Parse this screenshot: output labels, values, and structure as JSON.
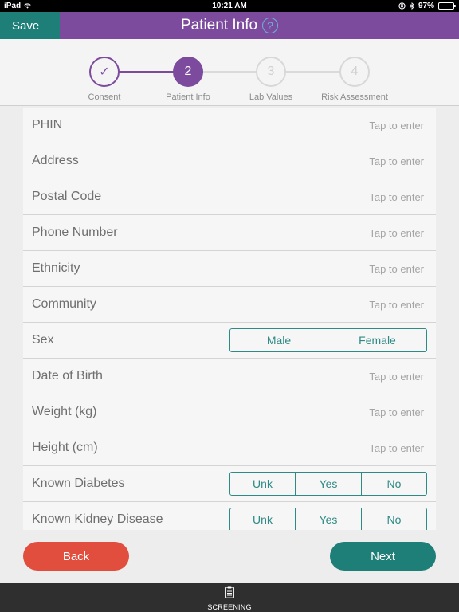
{
  "status_bar": {
    "device": "iPad",
    "time": "10:21 AM",
    "battery": "97%",
    "icons": [
      "wifi-icon",
      "orientation-lock-icon",
      "bluetooth-icon",
      "battery-icon"
    ]
  },
  "header": {
    "save_label": "Save",
    "title": "Patient Info",
    "help_glyph": "?"
  },
  "stepper": {
    "steps": [
      {
        "number": "✓",
        "label": "Consent",
        "state": "done"
      },
      {
        "number": "2",
        "label": "Patient Info",
        "state": "active"
      },
      {
        "number": "3",
        "label": "Lab Values",
        "state": "pending"
      },
      {
        "number": "4",
        "label": "Risk Assessment",
        "state": "pending"
      }
    ]
  },
  "form": {
    "rows": [
      {
        "label": "PHIN",
        "value": "Tap to enter"
      },
      {
        "label": "Address",
        "value": "Tap to enter"
      },
      {
        "label": "Postal Code",
        "value": "Tap to enter"
      },
      {
        "label": "Phone Number",
        "value": "Tap to enter"
      },
      {
        "label": "Ethnicity",
        "value": "Tap to enter"
      },
      {
        "label": "Community",
        "value": "Tap to enter"
      },
      {
        "label": "Sex",
        "options": [
          "Male",
          "Female"
        ]
      },
      {
        "label": "Date of Birth",
        "value": "Tap to enter"
      },
      {
        "label": "Weight (kg)",
        "value": "Tap to enter"
      },
      {
        "label": "Height (cm)",
        "value": "Tap to enter"
      },
      {
        "label": "Known Diabetes",
        "options": [
          "Unk",
          "Yes",
          "No"
        ]
      },
      {
        "label": "Known Kidney Disease",
        "options": [
          "Unk",
          "Yes",
          "No"
        ]
      }
    ]
  },
  "footer": {
    "back_label": "Back",
    "next_label": "Next"
  },
  "tabbar": {
    "tab_label": "SCREENING",
    "tab_icon": "clipboard-icon"
  },
  "colors": {
    "header_purple": "#7d4b9e",
    "teal": "#1e7f78",
    "back_red": "#e24e3e",
    "tabbar_dark": "#2f2f2f"
  }
}
